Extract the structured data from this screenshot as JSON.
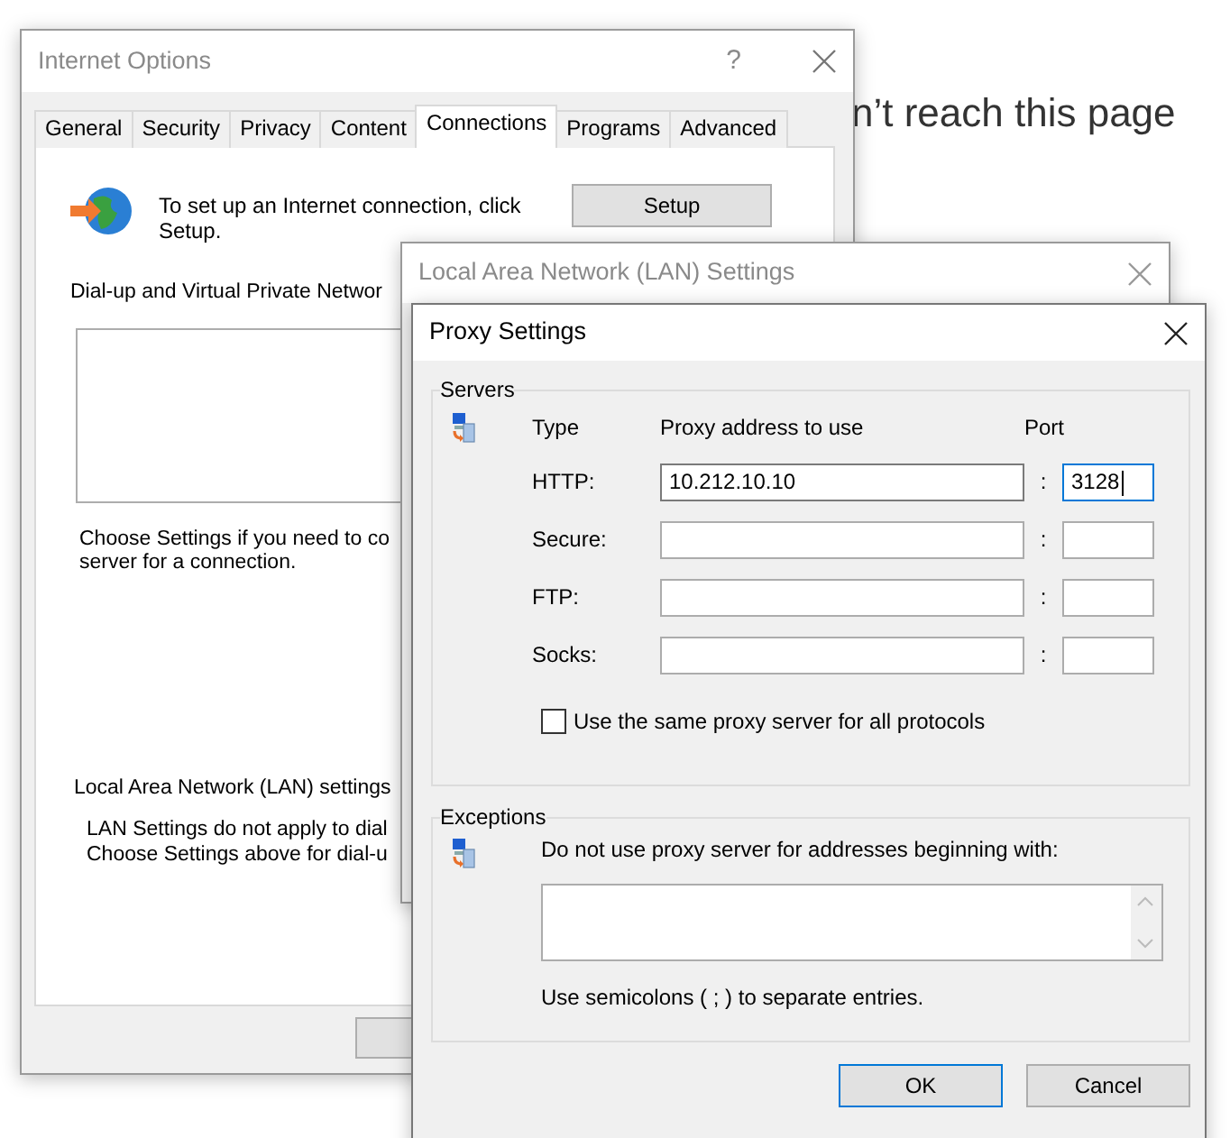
{
  "background_page": {
    "heading": "n’t reach this page"
  },
  "internet_options": {
    "title": "Internet Options",
    "help_button": "?",
    "tabs": [
      {
        "label": "General",
        "selected": false
      },
      {
        "label": "Security",
        "selected": false
      },
      {
        "label": "Privacy",
        "selected": false
      },
      {
        "label": "Content",
        "selected": false
      },
      {
        "label": "Connections",
        "selected": true
      },
      {
        "label": "Programs",
        "selected": false
      },
      {
        "label": "Advanced",
        "selected": false
      }
    ],
    "setup_text": "To set up an Internet connection, click Setup.",
    "setup_button": "Setup",
    "dialup_heading": "Dial-up and Virtual Private Networ",
    "dialup_hint": [
      "Choose Settings if you need to co",
      "server for a connection."
    ],
    "lan_heading": "Local Area Network (LAN) settings",
    "lan_note": [
      "LAN Settings do not apply to dial",
      "Choose Settings above for dial-u"
    ]
  },
  "lan_window": {
    "title": "Local Area Network (LAN) Settings"
  },
  "proxy_window": {
    "title": "Proxy Settings",
    "servers": {
      "label": "Servers",
      "headers": [
        "Type",
        "Proxy address to use",
        "Port"
      ],
      "rows": [
        {
          "type": "HTTP:",
          "address": "10.212.10.10",
          "separator": ":",
          "port": "3128",
          "focused": true
        },
        {
          "type": "Secure:",
          "separator": ":",
          "focused": false
        },
        {
          "type": "FTP:",
          "separator": ":",
          "focused": false
        },
        {
          "type": "Socks:",
          "separator": ":",
          "focused": false
        }
      ],
      "same_proxy": {
        "label": "Use the same proxy server for all protocols",
        "checked": false
      }
    },
    "exceptions": {
      "label": "Exceptions",
      "prompt": "Do not use proxy server for addresses beginning with:",
      "hint": "Use semicolons ( ; ) to separate entries."
    },
    "buttons": [
      {
        "label": "OK",
        "default": true
      },
      {
        "label": "Cancel",
        "default": false
      }
    ]
  }
}
